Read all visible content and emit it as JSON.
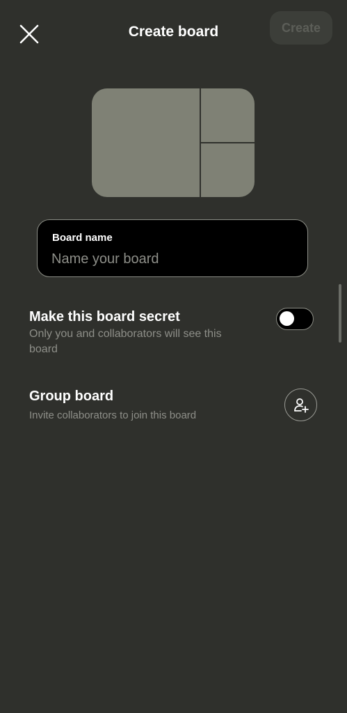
{
  "header": {
    "title": "Create board",
    "create_label": "Create",
    "close_icon": "close-icon"
  },
  "cover": {
    "icon": "board-cover-placeholder"
  },
  "board_name": {
    "label": "Board name",
    "value": "",
    "placeholder": "Name your board"
  },
  "secret": {
    "title": "Make this board secret",
    "subtitle_line1": "Only you and collaborators will see this",
    "subtitle_line2": "board",
    "enabled": false
  },
  "group": {
    "title": "Group board",
    "subtitle": "Invite collaborators to join this board",
    "icon": "add-person-icon"
  },
  "colors": {
    "background": "#2f302c",
    "cover": "#7f8175",
    "muted_text": "#8e8f89",
    "create_button_bg": "#3c3e39",
    "create_button_text": "#5c5e58"
  }
}
